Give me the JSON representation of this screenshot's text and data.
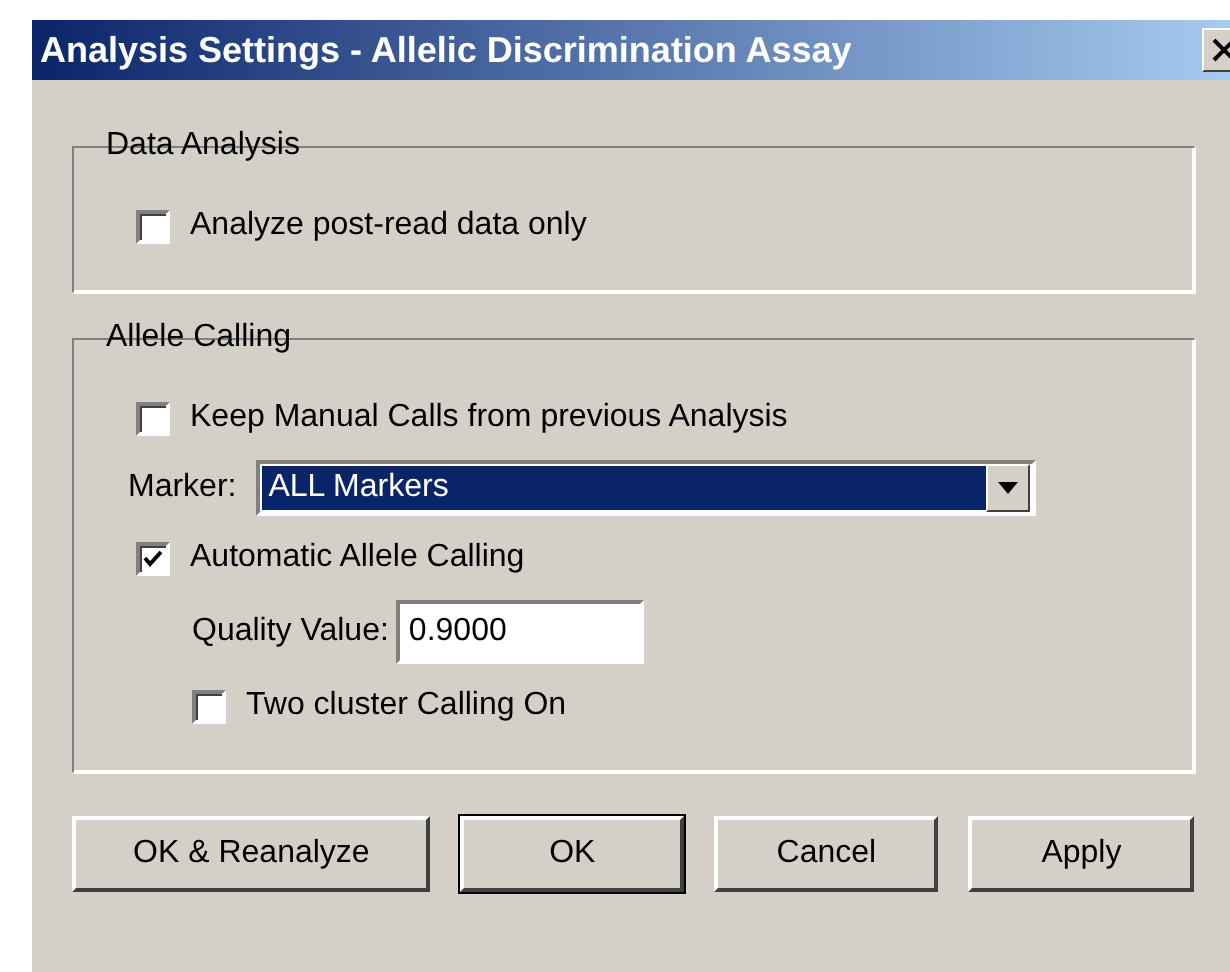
{
  "window": {
    "title": "Analysis Settings - Allelic Discrimination Assay"
  },
  "groups": [
    {
      "title": "Data Analysis",
      "items": [
        {
          "kind": "checkbox",
          "label": "Analyze post-read data only",
          "checked": false
        }
      ]
    },
    {
      "title": "Allele Calling",
      "items": [
        {
          "kind": "checkbox",
          "label": "Keep Manual Calls from previous Analysis",
          "checked": false
        },
        {
          "kind": "combo",
          "label": "Marker:",
          "value": "ALL Markers"
        },
        {
          "kind": "checkbox",
          "label": "Automatic Allele Calling",
          "checked": true,
          "children": [
            {
              "kind": "field",
              "label": "Quality Value:",
              "value": "0.9000"
            },
            {
              "kind": "checkbox",
              "label": "Two cluster Calling On",
              "checked": false
            }
          ]
        }
      ]
    }
  ],
  "buttons": [
    {
      "label": "OK & Reanalyze",
      "default": false
    },
    {
      "label": "OK",
      "default": true
    },
    {
      "label": "Cancel",
      "default": false
    },
    {
      "label": "Apply",
      "default": false
    }
  ]
}
